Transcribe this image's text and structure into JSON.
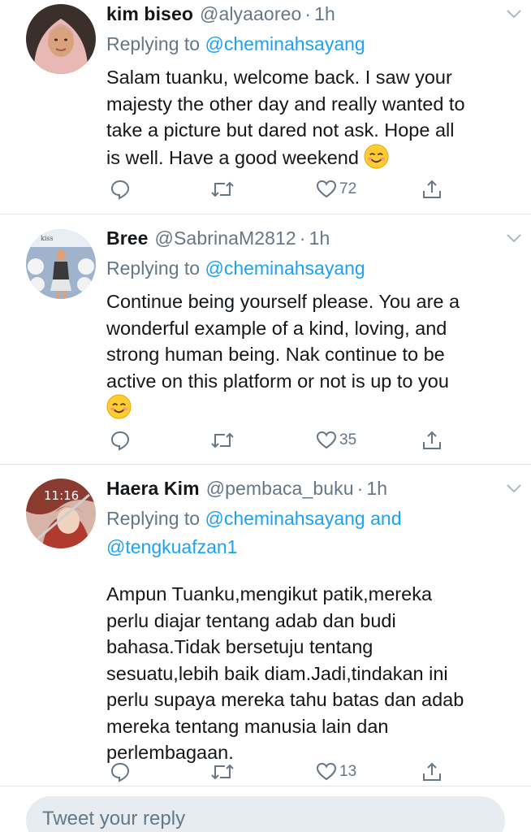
{
  "tweets": [
    {
      "name": "kim biseo",
      "handle": "@alyaaoreo",
      "time": "1h",
      "replying_label": "Replying to",
      "mentions": [
        "@cheminahsayang"
      ],
      "mention_joiner": "",
      "body_lines": [
        "Salam tuanku, welcome back. I saw your",
        "majesty the other day and really wanted to",
        "take a picture but dared not ask. Hope all",
        "is well. Have a good weekend"
      ],
      "emoji": "smiling-face-emoji",
      "likes": "72"
    },
    {
      "name": "Bree",
      "handle": "@SabrinaM2812",
      "time": "1h",
      "replying_label": "Replying to",
      "mentions": [
        "@cheminahsayang"
      ],
      "mention_joiner": "",
      "body_lines": [
        "Continue being yourself please. You are a",
        "wonderful example of a kind, loving, and",
        "strong human being. Nak continue to be",
        "active on this platform or not is up to you"
      ],
      "emoji": "smiling-face-emoji",
      "likes": "35"
    },
    {
      "name": "Haera Kim",
      "handle": "@pembaca_buku",
      "time": "1h",
      "replying_label": "Replying to",
      "mentions": [
        "@cheminahsayang",
        "@tengkuafzan1"
      ],
      "mention_joiner": "and",
      "avatar_text": "11:16",
      "body_lines": [
        "Ampun Tuanku,mengikut patik,mereka",
        "perlu diajar tentang adab dan budi",
        "bahasa.Tidak bersetuju tentang",
        "sesuatu,lebih baik diam.Jadi,tindakan ini",
        "perlu supaya mereka tahu batas dan adab",
        "mereka tentang manusia lain dan",
        "perlembagaan."
      ],
      "likes": "13"
    }
  ],
  "reply_box": {
    "placeholder": "Tweet your reply"
  },
  "colors": {
    "accent": "#1da1f2",
    "secondary_text": "#657786",
    "divider": "#e1e8ed",
    "reply_bg": "#e6ecf0"
  },
  "icons": [
    "reply-icon",
    "retweet-icon",
    "like-icon",
    "share-icon",
    "chevron-down-icon"
  ]
}
